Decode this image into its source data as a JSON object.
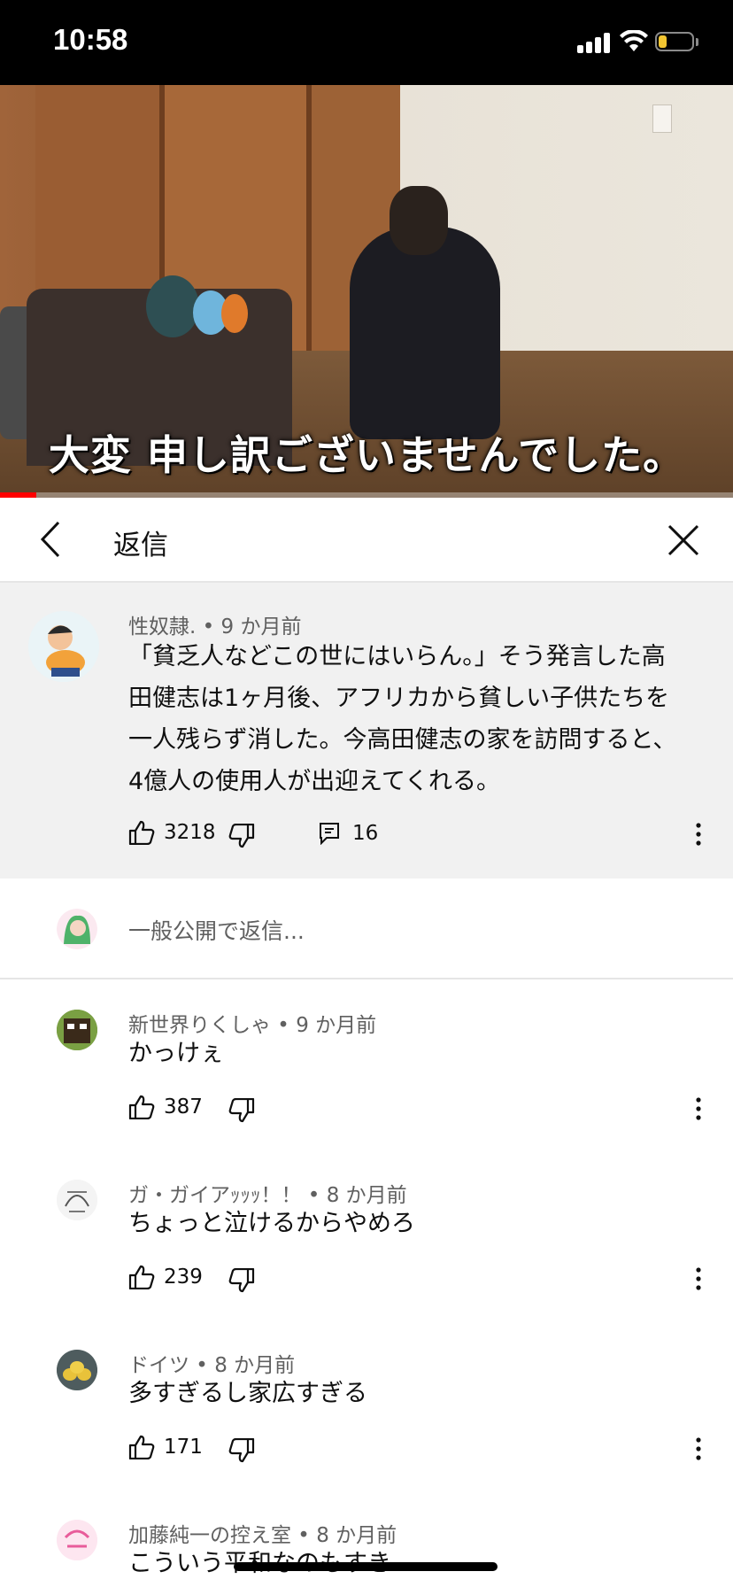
{
  "status_bar": {
    "time": "10:58",
    "battery_color": "#f2c531"
  },
  "video": {
    "caption": "大変 申し訳ございませんでした。",
    "progress_fraction": 0.05,
    "progress_color": "#ff0000"
  },
  "replies_panel": {
    "title": "返信",
    "back_icon": "chevron-left-icon",
    "close_icon": "close-icon"
  },
  "parent_comment": {
    "author": "性奴隷.",
    "age": "9 か月前",
    "lines": [
      "「貧乏人などこの世にはいらん。」そう発言した高",
      "田健志は1ヶ月後、アフリカから貧しい子供たちを",
      "一人残らず消した。今高田健志の家を訪問すると、",
      "4億人の使用人が出迎えてくれる。"
    ],
    "likes": "3218",
    "reply_count": "16"
  },
  "reply_input": {
    "placeholder": "一般公開で返信..."
  },
  "replies": [
    {
      "author": "新世界りくしゃ",
      "age": "9 か月前",
      "text": "かっけぇ",
      "likes": "387"
    },
    {
      "author": "ガ・ガイアｯｯｯ！！",
      "age": "8 か月前",
      "text": "ちょっと泣けるからやめろ",
      "likes": "239"
    },
    {
      "author": "ドイツ",
      "age": "8 か月前",
      "text": "多すぎるし家広すぎる",
      "likes": "171"
    },
    {
      "author": "加藤純一の控え室",
      "age": "8 か月前",
      "text": "こういう平和なのもすき",
      "likes": ""
    }
  ],
  "separator": " • "
}
